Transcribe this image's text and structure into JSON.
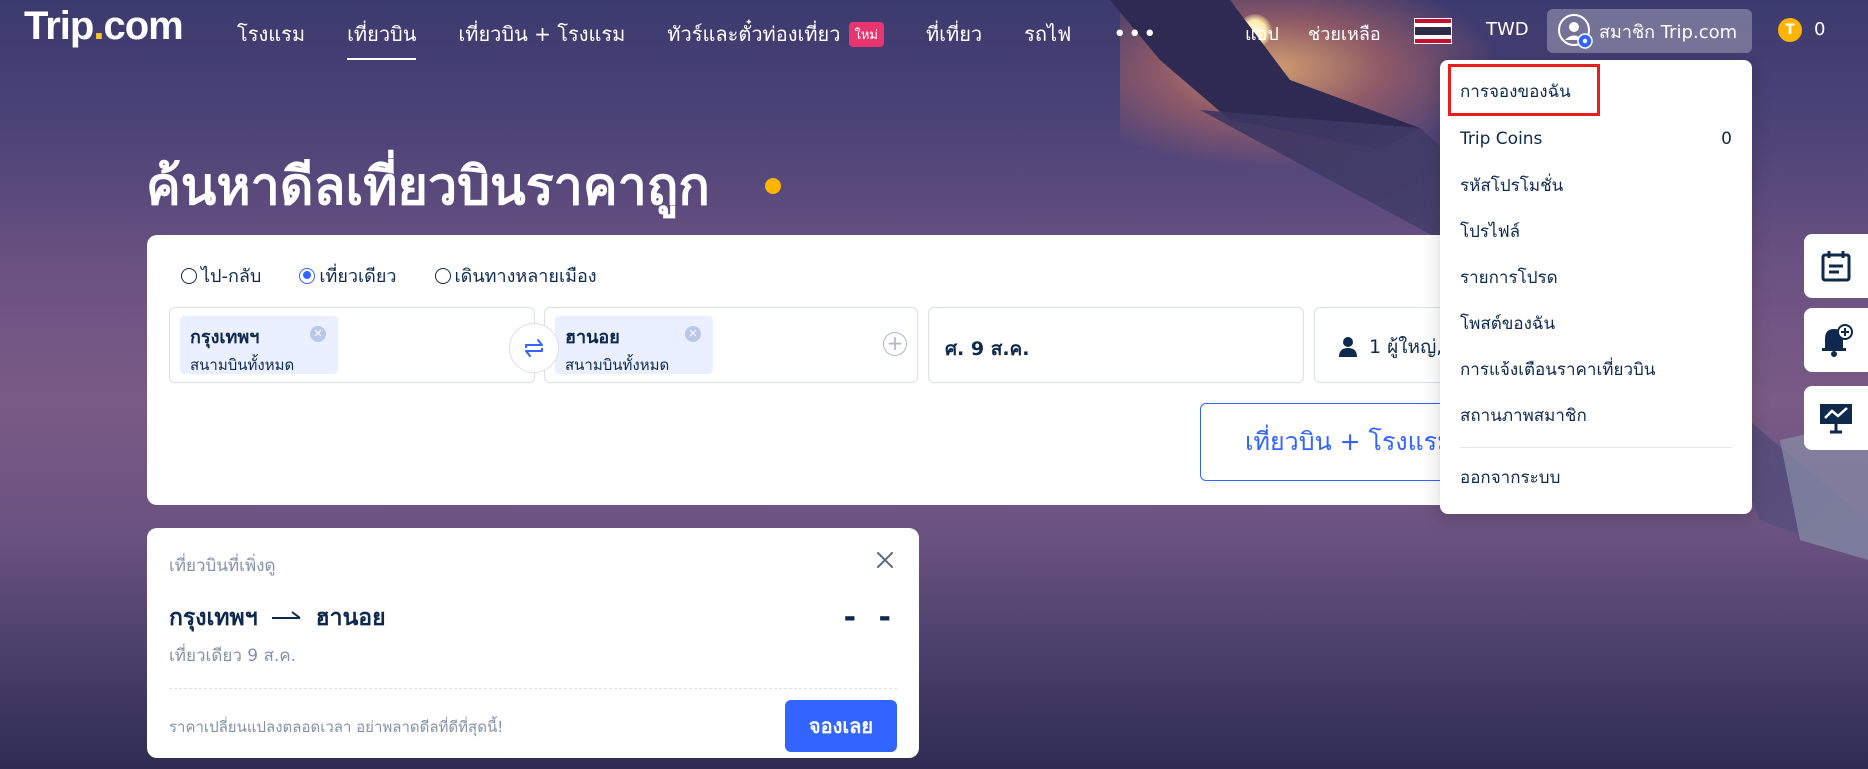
{
  "brand": {
    "logo_main": "Trip",
    "logo_dot": ".",
    "logo_tail": "com",
    "accent": "#3264ff",
    "coin_color": "#ffb400"
  },
  "nav": {
    "items": [
      {
        "label": "โรงแรม",
        "active": false
      },
      {
        "label": "เที่ยวบิน",
        "active": true
      },
      {
        "label": "เที่ยวบิน + โรงแรม",
        "active": false
      },
      {
        "label": "ทัวร์และตั๋วท่องเที่ยว",
        "active": false,
        "badge": "ใหม่"
      },
      {
        "label": "ที่เที่ยว",
        "active": false
      },
      {
        "label": "รถไฟ",
        "active": false
      }
    ],
    "more_icon": "more-dots-icon"
  },
  "header_right": {
    "app": "แอป",
    "help": "ช่วยเหลือ",
    "currency": "TWD",
    "member": "สมาชิก Trip.com",
    "coin_symbol": "T",
    "coin_count": "0"
  },
  "hero": {
    "title": "ค้นหาดีลเที่ยวบินราคาถูก"
  },
  "search": {
    "trip_types": [
      {
        "label": "ไป-กลับ",
        "checked": false
      },
      {
        "label": "เที่ยวเดียว",
        "checked": true
      },
      {
        "label": "เดินทางหลายเมือง",
        "checked": false
      }
    ],
    "from": {
      "city": "กรุงเทพฯ",
      "airport": "สนามบินทั้งหมด"
    },
    "to": {
      "city": "ฮานอย",
      "airport": "สนามบินทั้งหมด"
    },
    "date": "ศ. 9 ส.ค.",
    "passengers": "1 ผู้ใหญ่,",
    "flight_hotel_button": "เที่ยวบิน + โรงแรม"
  },
  "recent": {
    "title": "เที่ยวบินที่เพิ่งดู",
    "from": "กรุงเทพฯ",
    "to": "ฮานอย",
    "trip_info": "เที่ยวเดียว  9 ส.ค.",
    "price": "- -",
    "note": "ราคาเปลี่ยนแปลงตลอดเวลา อย่าพลาดดีลที่ดีที่สุดนี้!",
    "book_button": "จองเลย"
  },
  "dropdown": {
    "items": [
      {
        "label": "การจองของฉัน",
        "value": ""
      },
      {
        "label": "Trip Coins",
        "value": "0"
      },
      {
        "label": "รหัสโปรโมชั่น",
        "value": ""
      },
      {
        "label": "โปรไฟล์",
        "value": ""
      },
      {
        "label": "รายการโปรด",
        "value": ""
      },
      {
        "label": "โพสต์ของฉัน",
        "value": ""
      },
      {
        "label": "การแจ้งเตือนราคาเที่ยวบิน",
        "value": ""
      },
      {
        "label": "สถานภาพสมาชิก",
        "value": ""
      }
    ],
    "logout": "ออกจากระบบ",
    "highlight_color": "#e81e1e"
  },
  "side_widgets": [
    {
      "icon": "calendar-icon"
    },
    {
      "icon": "bell-add-icon"
    },
    {
      "icon": "trend-chart-icon"
    }
  ]
}
